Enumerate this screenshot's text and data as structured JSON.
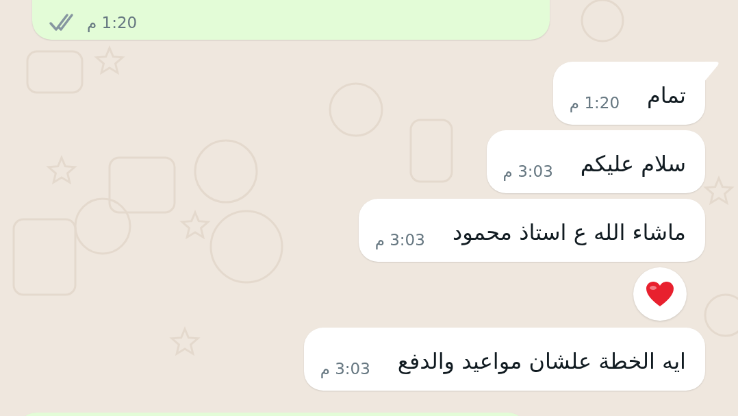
{
  "messages": [
    {
      "kind": "sent",
      "time": "1:20 م",
      "delivered": true,
      "read": false
    },
    {
      "kind": "received",
      "text": "تمام",
      "time": "1:20 م",
      "tail": true
    },
    {
      "kind": "received",
      "text": "سلام عليكم",
      "time": "3:03 م",
      "tail": false
    },
    {
      "kind": "received",
      "text": "ماشاء الله ع استاذ محمود",
      "time": "3:03 م",
      "tail": false,
      "reaction": {
        "kind": "heart"
      }
    },
    {
      "kind": "received",
      "text": "ايه الخطة علشان مواعيد والدفع",
      "time": "3:03 م",
      "tail": false
    },
    {
      "kind": "sent_partial"
    }
  ]
}
